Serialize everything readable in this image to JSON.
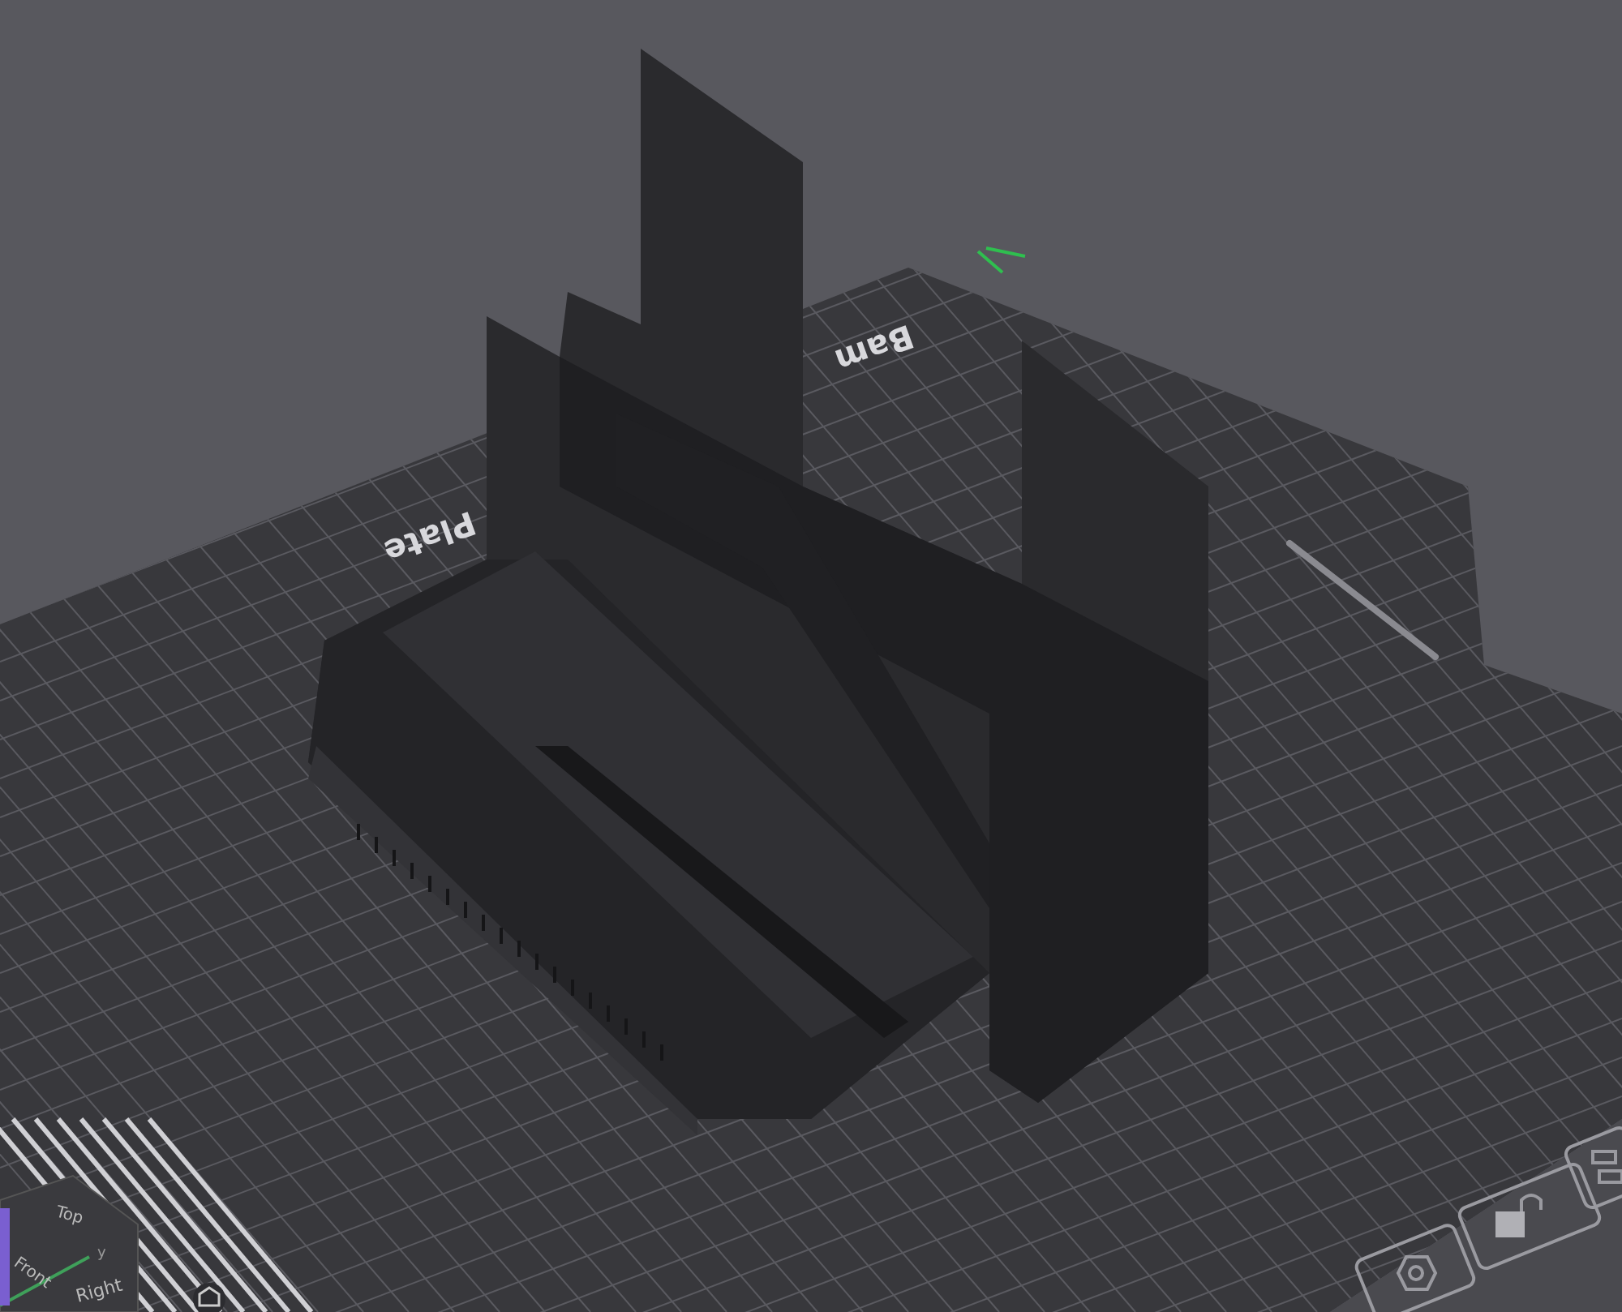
{
  "viewport": {
    "plate_labels": [
      "Bam",
      "Plate"
    ],
    "view_cube": {
      "faces": [
        "Top",
        "Front",
        "Right"
      ],
      "axis_label": "y"
    }
  }
}
